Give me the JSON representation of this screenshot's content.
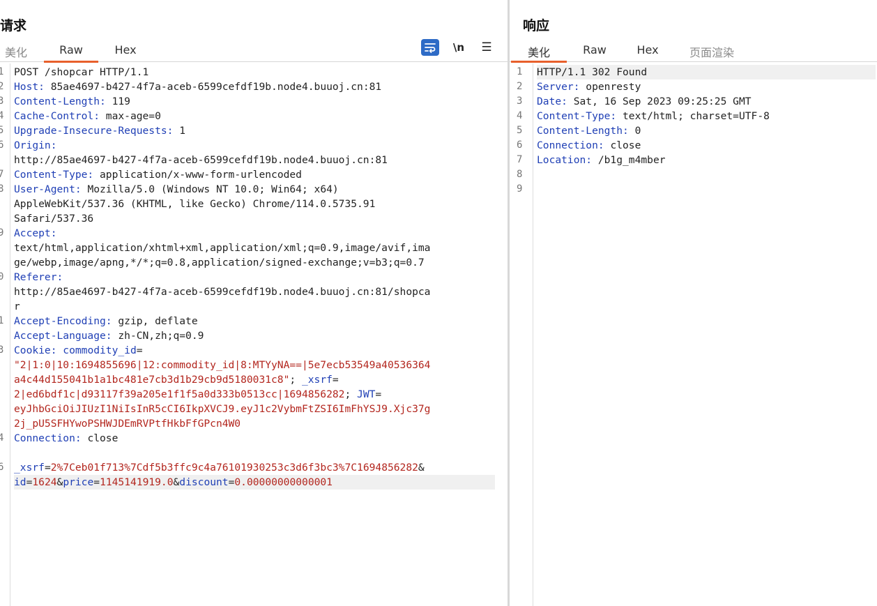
{
  "request": {
    "title": "请求",
    "tabs": [
      "美化",
      "Raw",
      "Hex"
    ],
    "active_tab": "Raw",
    "toolbar": {
      "wrap_icon": "wrap-icon",
      "newline_label": "\\n",
      "menu_label": "☰"
    },
    "line_numbers": [
      "1",
      "2",
      "3",
      "4",
      "5",
      "6",
      "7",
      "8",
      "9",
      "0",
      "1",
      "3",
      "4",
      "6"
    ],
    "lines": {
      "l1": "POST /shopcar HTTP/1.1",
      "l2k": "Host:",
      "l2v": " 85ae4697-b427-4f7a-aceb-6599cefdf19b.node4.buuoj.cn:81",
      "l3k": "Content-Length:",
      "l3v": " 119",
      "l4k": "Cache-Control:",
      "l4v": " max-age=0",
      "l5k": "Upgrade-Insecure-Requests:",
      "l5v": " 1",
      "l6k": "Origin:",
      "l6v": "http://85ae4697-b427-4f7a-aceb-6599cefdf19b.node4.buuoj.cn:81",
      "l7k": "Content-Type:",
      "l7v": " application/x-www-form-urlencoded",
      "l8k": "User-Agent:",
      "l8v": " Mozilla/5.0 (Windows NT 10.0; Win64; x64)",
      "l8v2": "AppleWebKit/537.36 (KHTML, like Gecko) Chrome/114.0.5735.91",
      "l8v3": "Safari/537.36",
      "l9k": "Accept:",
      "l9v": "text/html,application/xhtml+xml,application/xml;q=0.9,image/avif,ima",
      "l9v2": "ge/webp,image/apng,*/*;q=0.8,application/signed-exchange;v=b3;q=0.7",
      "l10k": "Referer:",
      "l10v": "http://85ae4697-b427-4f7a-aceb-6599cefdf19b.node4.buuoj.cn:81/shopca",
      "l10v2": "r",
      "l11k": "Accept-Encoding:",
      "l11v": " gzip, deflate",
      "l12k": "Accept-Language:",
      "l12v": " zh-CN,zh;q=0.9",
      "l13k": "Cookie:",
      "l13n1": " commodity_id",
      "l13e": "=",
      "l13s1": "\"2|1:0|10:1694855696|12:commodity_id|8:MTYyNA==|5e7ecb53549a40536364",
      "l13s2": "a4c44d155041b1a1bc481e7cb3d1b29cb9d5180031c8\"",
      "l13sep": "; ",
      "l13n2": "_xsrf",
      "l13e2": "=",
      "l13s3": "2|ed6bdf1c|d93117f39a205e1f1f5a0d333b0513cc|1694856282",
      "l13sep2": "; ",
      "l13n3": "JWT",
      "l13e3": "=",
      "l13s4": "eyJhbGciOiJIUzI1NiIsInR5cCI6IkpXVCJ9.eyJ1c2VybmFtZSI6ImFhYSJ9.Xjc37g",
      "l13s5": "2j_pU5SFHYwoPSHWJDEmRVPtfHkbFfGPcn4W0",
      "l14k": "Connection:",
      "l14v": " close",
      "l16k1": "_xsrf",
      "l16e1": "=",
      "l16v1": "2%7Ceb01f713%7Cdf5b3ffc9c4a76101930253c3d6f3bc3%7C1694856282",
      "l16amp": "&",
      "l17k1": "id",
      "l17e1": "=",
      "l17v1": "1624",
      "l17a1": "&",
      "l17k2": "price",
      "l17e2": "=",
      "l17v2": "1145141919.0",
      "l17a2": "&",
      "l17k3": "discount",
      "l17e3": "=",
      "l17v3": "0.00000000000001"
    }
  },
  "response": {
    "title": "响应",
    "tabs": [
      "美化",
      "Raw",
      "Hex",
      "页面渲染"
    ],
    "active_tab": "美化",
    "line_numbers": [
      "1",
      "2",
      "3",
      "4",
      "5",
      "6",
      "7",
      "8",
      "9"
    ],
    "lines": {
      "l1": "HTTP/1.1 302 Found",
      "l2k": "Server:",
      "l2v": " openresty",
      "l3k": "Date:",
      "l3v": " Sat, 16 Sep 2023 09:25:25 GMT",
      "l4k": "Content-Type:",
      "l4v": " text/html; charset=UTF-8",
      "l5k": "Content-Length:",
      "l5v": " 0",
      "l6k": "Connection:",
      "l6v": " close",
      "l7k": "Location:",
      "l7v": " /b1g_m4mber"
    }
  },
  "colors": {
    "accent": "#e8602c",
    "key": "#1f3fb5",
    "string": "#b3261e",
    "wrap_button": "#2e6bc6"
  }
}
